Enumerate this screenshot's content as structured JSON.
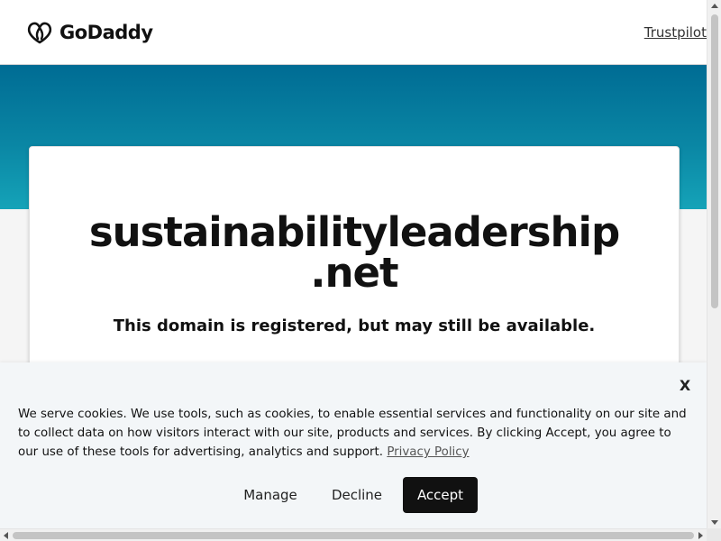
{
  "header": {
    "logo_text": "GoDaddy",
    "logo_icon": "godaddy-heart-icon",
    "trustpilot_label": "Trustpilot"
  },
  "card": {
    "domain_line1": "sustainabilityleadership",
    "domain_line2": ".net",
    "subtitle": "This domain is registered, but may still be available."
  },
  "cookie_banner": {
    "close_label": "X",
    "text": "We serve cookies. We use tools, such as cookies, to enable essential services and functionality on our site and to collect data on how visitors interact with our site, products and services. By clicking Accept, you agree to our use of these tools for advertising, analytics and support.",
    "privacy_link": "Privacy Policy",
    "manage_label": "Manage",
    "decline_label": "Decline",
    "accept_label": "Accept"
  },
  "colors": {
    "hero_top": "#006c94",
    "hero_bottom": "#15a3b8",
    "accept_bg": "#111111",
    "banner_bg": "#f3f6f8"
  }
}
